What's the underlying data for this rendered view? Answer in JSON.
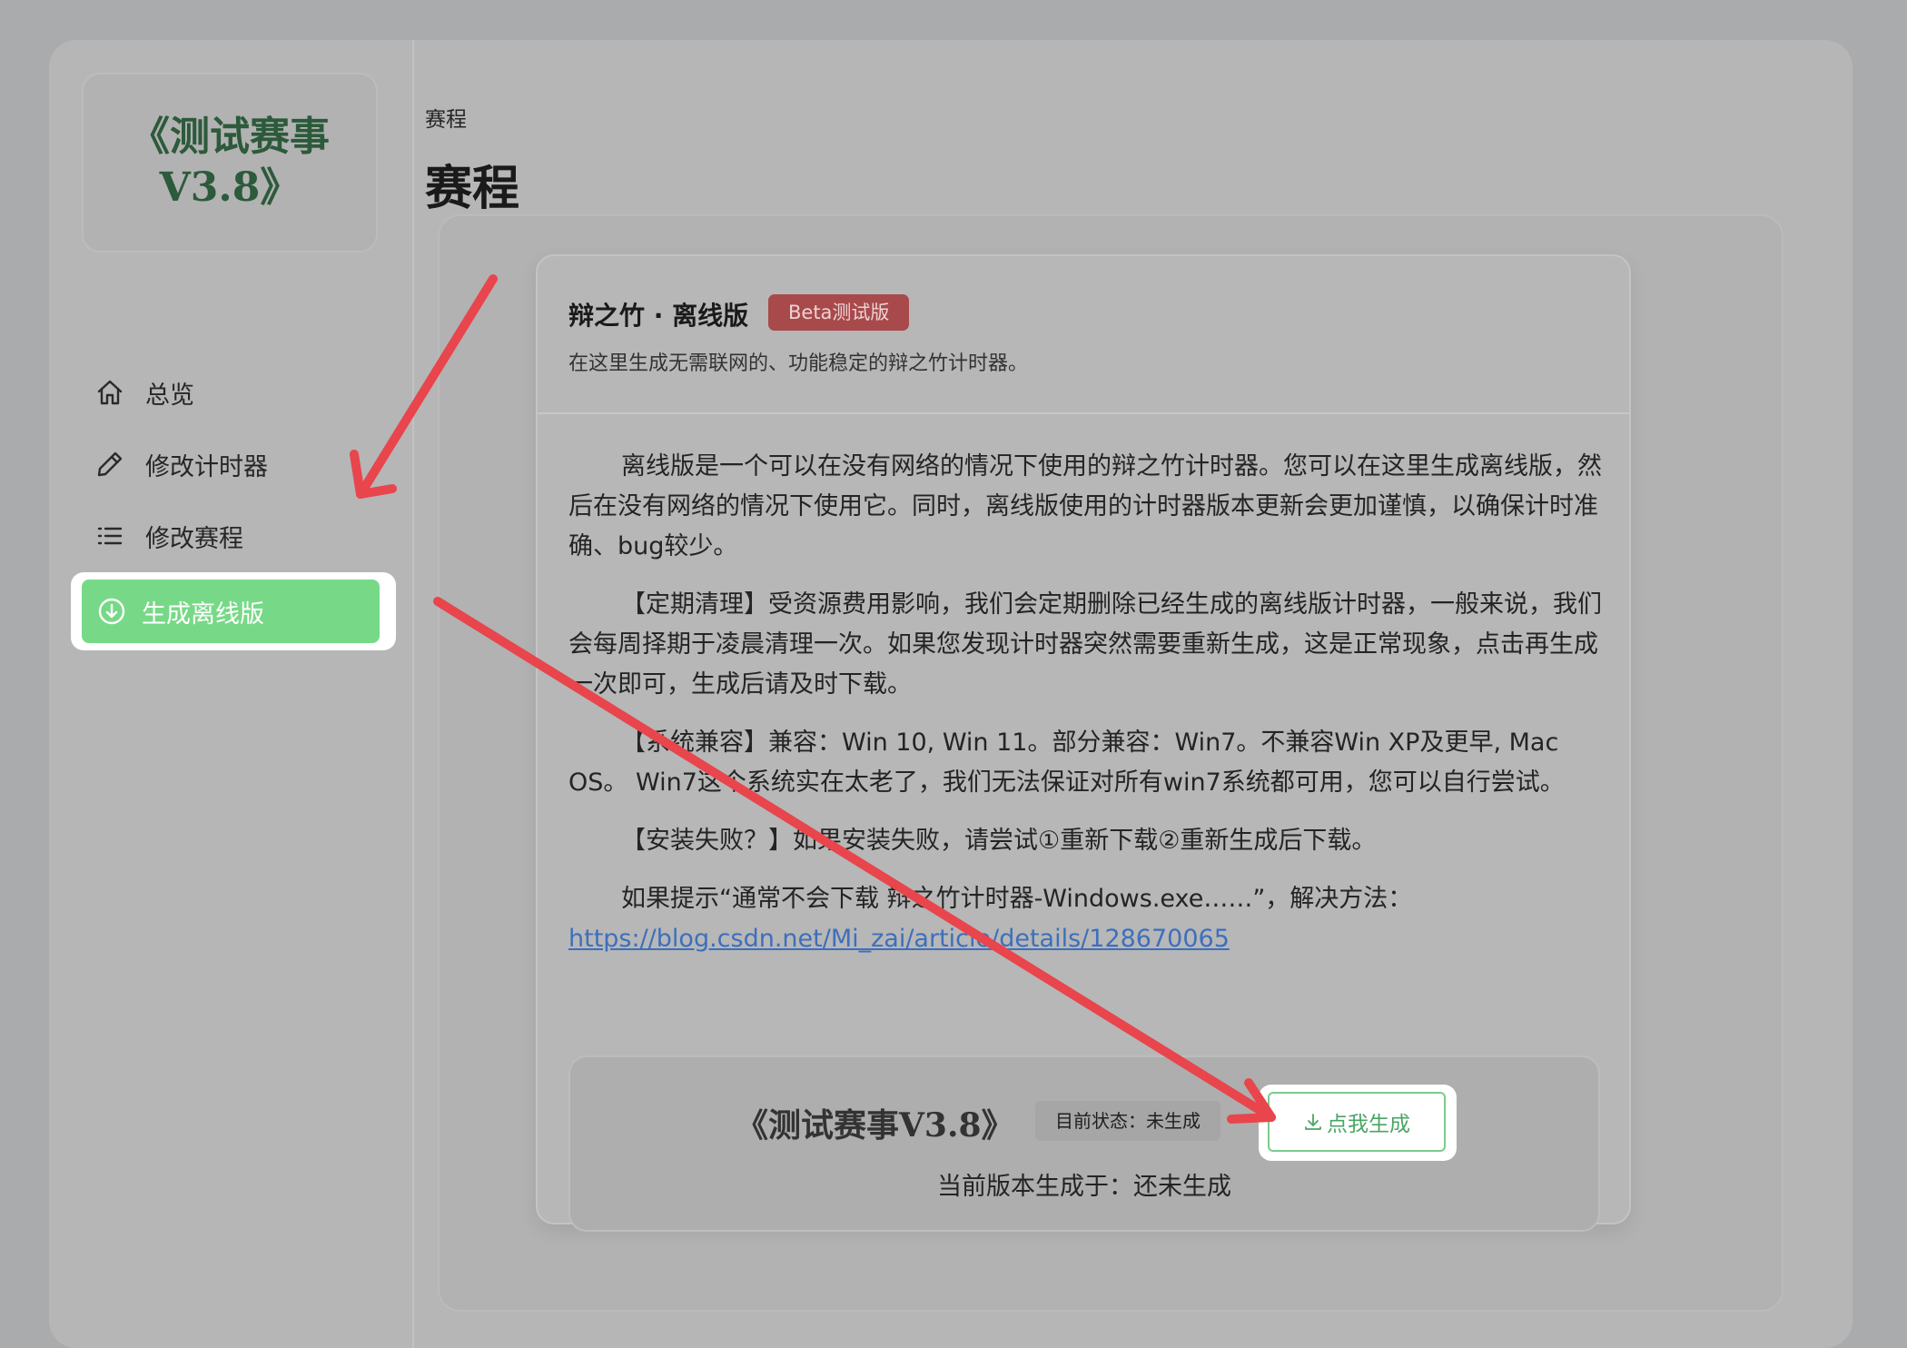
{
  "sidebar": {
    "logo_text": "《测试赛事V3.8》",
    "items": [
      {
        "label": "总览",
        "icon": "home-icon"
      },
      {
        "label": "修改计时器",
        "icon": "pencil-icon"
      },
      {
        "label": "修改赛程",
        "icon": "list-icon"
      },
      {
        "label": "生成离线版",
        "icon": "download-circle-icon",
        "active": true
      }
    ]
  },
  "header": {
    "breadcrumb": "赛程",
    "title": "赛程"
  },
  "card": {
    "title": "辩之竹 · 离线版",
    "badge": "Beta测试版",
    "subtitle": "在这里生成无需联网的、功能稳定的辩之竹计时器。",
    "paragraphs": [
      "离线版是一个可以在没有网络的情况下使用的辩之竹计时器。您可以在这里生成离线版，然后在没有网络的情况下使用它。同时，离线版使用的计时器版本更新会更加谨慎，以确保计时准确、bug较少。",
      "【定期清理】受资源费用影响，我们会定期删除已经生成的离线版计时器，一般来说，我们会每周择期于凌晨清理一次。如果您发现计时器突然需要重新生成，这是正常现象，点击再生成一次即可，生成后请及时下载。",
      "【系统兼容】兼容：Win 10, Win 11。部分兼容：Win7。不兼容Win XP及更早, Mac OS。 Win7这个系统实在太老了，我们无法保证对所有win7系统都可用，您可以自行尝试。",
      "【安装失败？】如果安装失败，请尝试①重新下载②重新生成后下载。"
    ],
    "hint_text": "如果提示“通常不会下载 辩之竹计时器-Windows.exe……”，解决方法：",
    "hint_link": "https://blog.csdn.net/Mi_zai/article/details/128670065"
  },
  "generator": {
    "name": "《测试赛事V3.8》",
    "status": "目前状态：未生成",
    "button_label": "点我生成",
    "generated_time": "当前版本生成于：还未生成"
  },
  "colors": {
    "accent_green": "#77d987",
    "badge_red": "#a8494b",
    "arrow_red": "#e8454d",
    "link_blue": "#3d6fbd"
  }
}
